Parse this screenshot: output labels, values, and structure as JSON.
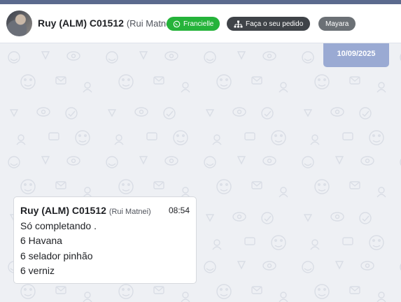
{
  "header": {
    "contact_name": "Ruy (ALM) C01512",
    "contact_sub": "(Rui Matnei)",
    "tags": [
      {
        "label": "Francielle",
        "icon": "whatsapp-icon",
        "color": "#25b33a"
      },
      {
        "label": "Faça o seu pedido",
        "icon": "sitemap-icon",
        "color": "#3f4348"
      },
      {
        "label": "Mayara",
        "color": "#6b7075"
      }
    ]
  },
  "chat": {
    "date_badge": "10/09/2025",
    "messages": [
      {
        "sender": "Ruy (ALM) C01512",
        "sender_sub": "(Rui Matnei)",
        "time": "08:54",
        "lines": [
          "Só completando .",
          "6 Havana",
          "6 selador pinhão",
          "6 verniz"
        ]
      }
    ]
  },
  "colors": {
    "accent": "#5b6a8e",
    "date_badge": "#9aaad3",
    "background": "#eef0f4"
  }
}
